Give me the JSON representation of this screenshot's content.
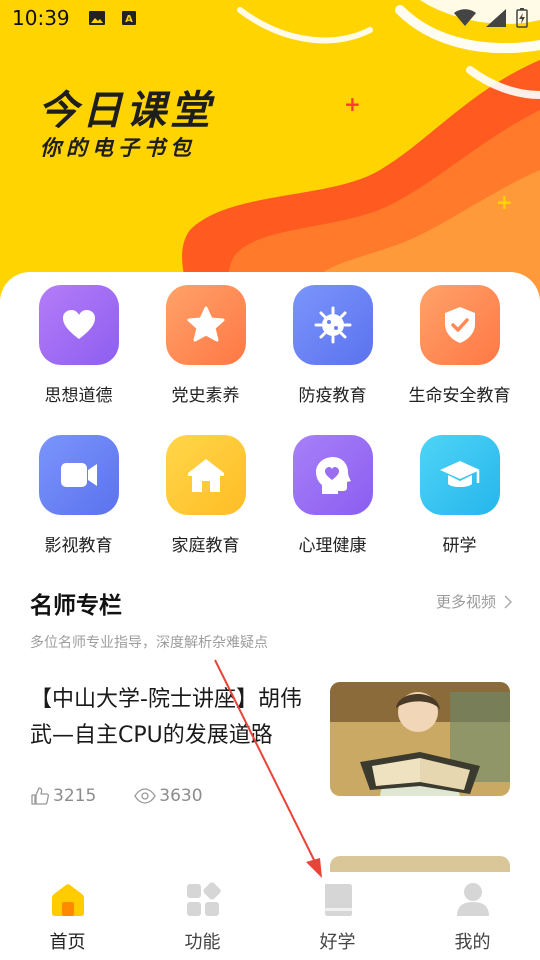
{
  "status": {
    "time": "10:39"
  },
  "hero": {
    "title": "今日课堂",
    "subtitle": "你的电子书包"
  },
  "features": [
    {
      "label": "思想道德",
      "icon": "heart-icon",
      "color": "#a86cf4"
    },
    {
      "label": "党史素养",
      "icon": "star-icon",
      "color": "#ff8a55"
    },
    {
      "label": "防疫教育",
      "icon": "virus-icon",
      "color": "#6e84f5"
    },
    {
      "label": "生命安全教育",
      "icon": "shield-check-icon",
      "color": "#ff8a55"
    },
    {
      "label": "影视教育",
      "icon": "video-camera-icon",
      "color": "#6e84f5"
    },
    {
      "label": "家庭教育",
      "icon": "house-icon",
      "color": "#ffc93d"
    },
    {
      "label": "心理健康",
      "icon": "head-heart-icon",
      "color": "#9a6ef4"
    },
    {
      "label": "研学",
      "icon": "graduation-cap-icon",
      "color": "#35c6f2"
    }
  ],
  "section": {
    "title": "名师专栏",
    "more_label": "更多视频",
    "subtitle": "多位名师专业指导，深度解析杂难疑点"
  },
  "article": {
    "title": "【中山大学-院士讲座】胡伟武—自主CPU的发展道路",
    "likes": "3215",
    "views": "3630"
  },
  "tabs": [
    {
      "label": "首页",
      "icon": "home-icon",
      "active": true
    },
    {
      "label": "功能",
      "icon": "grid-icon",
      "active": false
    },
    {
      "label": "好学",
      "icon": "book-icon",
      "active": false
    },
    {
      "label": "我的",
      "icon": "person-icon",
      "active": false
    }
  ],
  "colors": {
    "hero_bg": "#ffd400",
    "accent_orange": "#ff5a1f",
    "accent_yellow": "#ffcc00"
  }
}
